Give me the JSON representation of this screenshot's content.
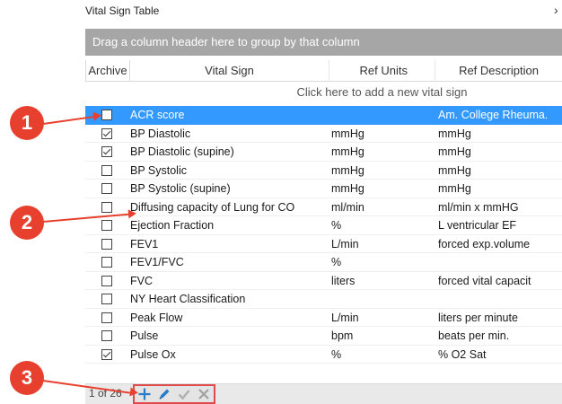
{
  "window": {
    "title": "Vital Sign Table",
    "close_glyph": "›"
  },
  "group_panel": {
    "text": "Drag a column header here to group by that column"
  },
  "columns": {
    "archive": "Archive",
    "vital_sign": "Vital Sign",
    "ref_units": "Ref Units",
    "ref_description": "Ref Description"
  },
  "add_row": {
    "text": "Click here to add a new vital sign"
  },
  "rows": [
    {
      "archived": false,
      "vital_sign": "ACR score",
      "ref_units": "",
      "ref_description": "Am. College Rheuma.",
      "selected": true
    },
    {
      "archived": true,
      "vital_sign": "BP Diastolic",
      "ref_units": "mmHg",
      "ref_description": "mmHg"
    },
    {
      "archived": true,
      "vital_sign": "BP Diastolic (supine)",
      "ref_units": "mmHg",
      "ref_description": "mmHg"
    },
    {
      "archived": false,
      "vital_sign": "BP Systolic",
      "ref_units": "mmHg",
      "ref_description": "mmHg"
    },
    {
      "archived": false,
      "vital_sign": "BP Systolic  (supine)",
      "ref_units": "mmHg",
      "ref_description": "mmHg"
    },
    {
      "archived": false,
      "vital_sign": "Diffusing capacity of Lung for CO",
      "ref_units": "ml/min",
      "ref_description": "ml/min x mmHG"
    },
    {
      "archived": false,
      "vital_sign": "Ejection Fraction",
      "ref_units": "%",
      "ref_description": "L ventricular EF"
    },
    {
      "archived": false,
      "vital_sign": "FEV1",
      "ref_units": "L/min",
      "ref_description": "forced exp.volume"
    },
    {
      "archived": false,
      "vital_sign": "FEV1/FVC",
      "ref_units": "%",
      "ref_description": ""
    },
    {
      "archived": false,
      "vital_sign": "FVC",
      "ref_units": "liters",
      "ref_description": "forced vital capacit"
    },
    {
      "archived": false,
      "vital_sign": "NY Heart Classification",
      "ref_units": "",
      "ref_description": ""
    },
    {
      "archived": false,
      "vital_sign": "Peak Flow",
      "ref_units": "L/min",
      "ref_description": "liters per minute"
    },
    {
      "archived": false,
      "vital_sign": "Pulse",
      "ref_units": "bpm",
      "ref_description": "beats per min."
    },
    {
      "archived": true,
      "vital_sign": "Pulse Ox",
      "ref_units": "%",
      "ref_description": "% O2 Sat"
    }
  ],
  "footer": {
    "pager_text": "1 of 26",
    "buttons": [
      {
        "name": "add-icon",
        "label": "Add"
      },
      {
        "name": "edit-icon",
        "label": "Edit"
      },
      {
        "name": "save-check-icon",
        "label": "Save"
      },
      {
        "name": "cancel-x-icon",
        "label": "Cancel"
      }
    ]
  },
  "callouts": [
    "1",
    "2",
    "3"
  ],
  "colors": {
    "accent": "#e8402e",
    "selection": "#3399ff",
    "group_panel": "#a6a6a6"
  }
}
